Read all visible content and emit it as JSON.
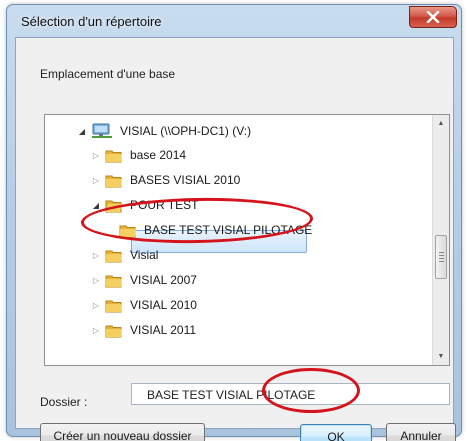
{
  "window": {
    "title": "Sélection d'un répertoire",
    "close_icon": "close-icon"
  },
  "prompt": "Emplacement d'une base",
  "tree": {
    "items": [
      {
        "label": "VISIAL (\\\\OPH-DC1) (V:)",
        "icon": "network-drive-icon",
        "expander": "expanded"
      },
      {
        "label": "base 2014",
        "icon": "folder-icon",
        "expander": "collapsed"
      },
      {
        "label": "BASES VISIAL 2010",
        "icon": "folder-icon",
        "expander": "collapsed"
      },
      {
        "label": "POUR TEST",
        "icon": "folder-icon",
        "expander": "expanded"
      },
      {
        "label": "BASE TEST VISIAL PILOTAGE",
        "icon": "folder-icon",
        "expander": "none",
        "selected": true
      },
      {
        "label": "Visial",
        "icon": "folder-icon",
        "expander": "collapsed"
      },
      {
        "label": "VISIAL 2007",
        "icon": "folder-icon",
        "expander": "collapsed"
      },
      {
        "label": "VISIAL 2010",
        "icon": "folder-icon",
        "expander": "collapsed"
      },
      {
        "label": "VISIAL 2011",
        "icon": "folder-icon",
        "expander": "collapsed"
      }
    ]
  },
  "folder": {
    "label": "Dossier :",
    "value": "BASE TEST VISIAL PILOTAGE"
  },
  "buttons": {
    "new_folder": "Créer un nouveau dossier",
    "ok": "OK",
    "cancel": "Annuler"
  },
  "colors": {
    "annotation": "#d4141a",
    "selection": "#cfe5fb",
    "folder": "#e8b23a"
  }
}
